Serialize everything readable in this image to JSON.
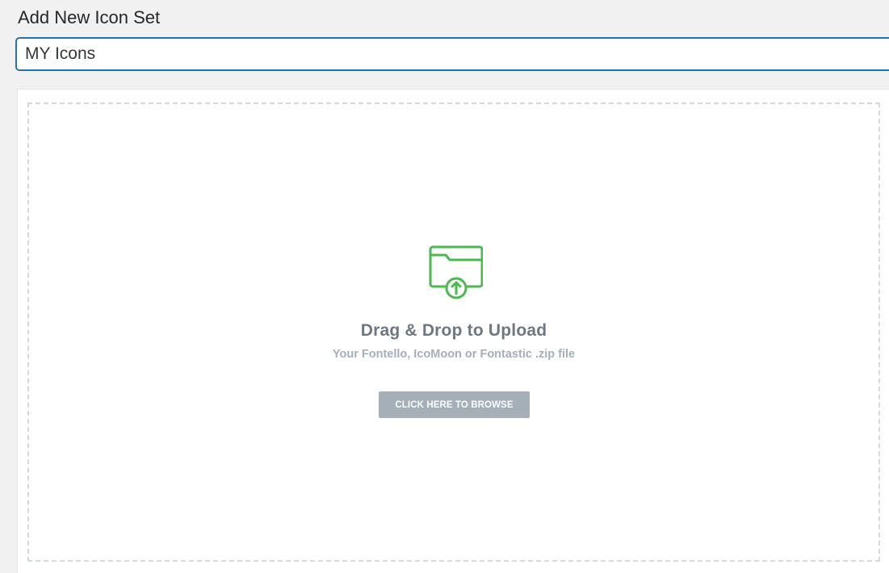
{
  "page": {
    "title": "Add New Icon Set"
  },
  "title_field": {
    "value": "MY Icons"
  },
  "uploader": {
    "icon": "folder-upload-icon",
    "heading": "Drag & Drop to Upload",
    "subheading": "Your Fontello, IcoMoon or Fontastic .zip file",
    "browse_label": "CLICK HERE TO BROWSE"
  },
  "colors": {
    "accent_green": "#4cb852",
    "input_focus": "#2271b1",
    "button_gray": "#a4afb7"
  }
}
